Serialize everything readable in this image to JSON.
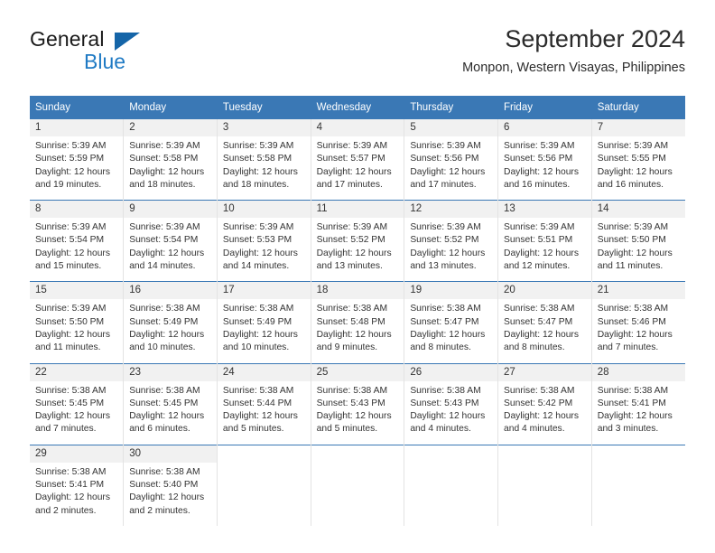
{
  "brand": {
    "name_part1": "General",
    "name_part2": "Blue",
    "triangle_color": "#1565a8",
    "blue_color": "#1f7ac4"
  },
  "header": {
    "title": "September 2024",
    "subtitle": "Monpon, Western Visayas, Philippines",
    "header_bg": "#3a78b5",
    "header_text": "#ffffff"
  },
  "weekday_headers": [
    "Sunday",
    "Monday",
    "Tuesday",
    "Wednesday",
    "Thursday",
    "Friday",
    "Saturday"
  ],
  "weeks": [
    [
      {
        "day": "1",
        "sunrise": "Sunrise: 5:39 AM",
        "sunset": "Sunset: 5:59 PM",
        "daylight1": "Daylight: 12 hours",
        "daylight2": "and 19 minutes."
      },
      {
        "day": "2",
        "sunrise": "Sunrise: 5:39 AM",
        "sunset": "Sunset: 5:58 PM",
        "daylight1": "Daylight: 12 hours",
        "daylight2": "and 18 minutes."
      },
      {
        "day": "3",
        "sunrise": "Sunrise: 5:39 AM",
        "sunset": "Sunset: 5:58 PM",
        "daylight1": "Daylight: 12 hours",
        "daylight2": "and 18 minutes."
      },
      {
        "day": "4",
        "sunrise": "Sunrise: 5:39 AM",
        "sunset": "Sunset: 5:57 PM",
        "daylight1": "Daylight: 12 hours",
        "daylight2": "and 17 minutes."
      },
      {
        "day": "5",
        "sunrise": "Sunrise: 5:39 AM",
        "sunset": "Sunset: 5:56 PM",
        "daylight1": "Daylight: 12 hours",
        "daylight2": "and 17 minutes."
      },
      {
        "day": "6",
        "sunrise": "Sunrise: 5:39 AM",
        "sunset": "Sunset: 5:56 PM",
        "daylight1": "Daylight: 12 hours",
        "daylight2": "and 16 minutes."
      },
      {
        "day": "7",
        "sunrise": "Sunrise: 5:39 AM",
        "sunset": "Sunset: 5:55 PM",
        "daylight1": "Daylight: 12 hours",
        "daylight2": "and 16 minutes."
      }
    ],
    [
      {
        "day": "8",
        "sunrise": "Sunrise: 5:39 AM",
        "sunset": "Sunset: 5:54 PM",
        "daylight1": "Daylight: 12 hours",
        "daylight2": "and 15 minutes."
      },
      {
        "day": "9",
        "sunrise": "Sunrise: 5:39 AM",
        "sunset": "Sunset: 5:54 PM",
        "daylight1": "Daylight: 12 hours",
        "daylight2": "and 14 minutes."
      },
      {
        "day": "10",
        "sunrise": "Sunrise: 5:39 AM",
        "sunset": "Sunset: 5:53 PM",
        "daylight1": "Daylight: 12 hours",
        "daylight2": "and 14 minutes."
      },
      {
        "day": "11",
        "sunrise": "Sunrise: 5:39 AM",
        "sunset": "Sunset: 5:52 PM",
        "daylight1": "Daylight: 12 hours",
        "daylight2": "and 13 minutes."
      },
      {
        "day": "12",
        "sunrise": "Sunrise: 5:39 AM",
        "sunset": "Sunset: 5:52 PM",
        "daylight1": "Daylight: 12 hours",
        "daylight2": "and 13 minutes."
      },
      {
        "day": "13",
        "sunrise": "Sunrise: 5:39 AM",
        "sunset": "Sunset: 5:51 PM",
        "daylight1": "Daylight: 12 hours",
        "daylight2": "and 12 minutes."
      },
      {
        "day": "14",
        "sunrise": "Sunrise: 5:39 AM",
        "sunset": "Sunset: 5:50 PM",
        "daylight1": "Daylight: 12 hours",
        "daylight2": "and 11 minutes."
      }
    ],
    [
      {
        "day": "15",
        "sunrise": "Sunrise: 5:39 AM",
        "sunset": "Sunset: 5:50 PM",
        "daylight1": "Daylight: 12 hours",
        "daylight2": "and 11 minutes."
      },
      {
        "day": "16",
        "sunrise": "Sunrise: 5:38 AM",
        "sunset": "Sunset: 5:49 PM",
        "daylight1": "Daylight: 12 hours",
        "daylight2": "and 10 minutes."
      },
      {
        "day": "17",
        "sunrise": "Sunrise: 5:38 AM",
        "sunset": "Sunset: 5:49 PM",
        "daylight1": "Daylight: 12 hours",
        "daylight2": "and 10 minutes."
      },
      {
        "day": "18",
        "sunrise": "Sunrise: 5:38 AM",
        "sunset": "Sunset: 5:48 PM",
        "daylight1": "Daylight: 12 hours",
        "daylight2": "and 9 minutes."
      },
      {
        "day": "19",
        "sunrise": "Sunrise: 5:38 AM",
        "sunset": "Sunset: 5:47 PM",
        "daylight1": "Daylight: 12 hours",
        "daylight2": "and 8 minutes."
      },
      {
        "day": "20",
        "sunrise": "Sunrise: 5:38 AM",
        "sunset": "Sunset: 5:47 PM",
        "daylight1": "Daylight: 12 hours",
        "daylight2": "and 8 minutes."
      },
      {
        "day": "21",
        "sunrise": "Sunrise: 5:38 AM",
        "sunset": "Sunset: 5:46 PM",
        "daylight1": "Daylight: 12 hours",
        "daylight2": "and 7 minutes."
      }
    ],
    [
      {
        "day": "22",
        "sunrise": "Sunrise: 5:38 AM",
        "sunset": "Sunset: 5:45 PM",
        "daylight1": "Daylight: 12 hours",
        "daylight2": "and 7 minutes."
      },
      {
        "day": "23",
        "sunrise": "Sunrise: 5:38 AM",
        "sunset": "Sunset: 5:45 PM",
        "daylight1": "Daylight: 12 hours",
        "daylight2": "and 6 minutes."
      },
      {
        "day": "24",
        "sunrise": "Sunrise: 5:38 AM",
        "sunset": "Sunset: 5:44 PM",
        "daylight1": "Daylight: 12 hours",
        "daylight2": "and 5 minutes."
      },
      {
        "day": "25",
        "sunrise": "Sunrise: 5:38 AM",
        "sunset": "Sunset: 5:43 PM",
        "daylight1": "Daylight: 12 hours",
        "daylight2": "and 5 minutes."
      },
      {
        "day": "26",
        "sunrise": "Sunrise: 5:38 AM",
        "sunset": "Sunset: 5:43 PM",
        "daylight1": "Daylight: 12 hours",
        "daylight2": "and 4 minutes."
      },
      {
        "day": "27",
        "sunrise": "Sunrise: 5:38 AM",
        "sunset": "Sunset: 5:42 PM",
        "daylight1": "Daylight: 12 hours",
        "daylight2": "and 4 minutes."
      },
      {
        "day": "28",
        "sunrise": "Sunrise: 5:38 AM",
        "sunset": "Sunset: 5:41 PM",
        "daylight1": "Daylight: 12 hours",
        "daylight2": "and 3 minutes."
      }
    ],
    [
      {
        "day": "29",
        "sunrise": "Sunrise: 5:38 AM",
        "sunset": "Sunset: 5:41 PM",
        "daylight1": "Daylight: 12 hours",
        "daylight2": "and 2 minutes."
      },
      {
        "day": "30",
        "sunrise": "Sunrise: 5:38 AM",
        "sunset": "Sunset: 5:40 PM",
        "daylight1": "Daylight: 12 hours",
        "daylight2": "and 2 minutes."
      },
      {
        "day": "",
        "sunrise": "",
        "sunset": "",
        "daylight1": "",
        "daylight2": ""
      },
      {
        "day": "",
        "sunrise": "",
        "sunset": "",
        "daylight1": "",
        "daylight2": ""
      },
      {
        "day": "",
        "sunrise": "",
        "sunset": "",
        "daylight1": "",
        "daylight2": ""
      },
      {
        "day": "",
        "sunrise": "",
        "sunset": "",
        "daylight1": "",
        "daylight2": ""
      },
      {
        "day": "",
        "sunrise": "",
        "sunset": "",
        "daylight1": "",
        "daylight2": ""
      }
    ]
  ]
}
